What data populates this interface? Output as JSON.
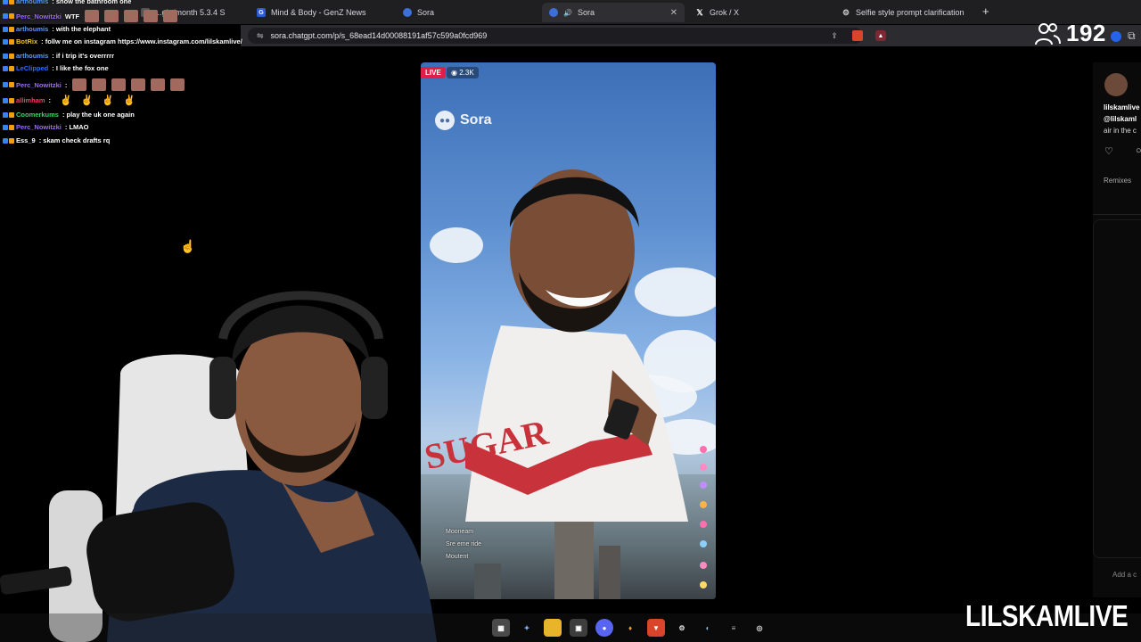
{
  "browser": {
    "tabs": [
      {
        "label": "...ght/month 5.3.4 S",
        "icon": "tab-icon",
        "active": false
      },
      {
        "label": "Mind & Body - GenZ News",
        "icon": "gz-icon",
        "active": false
      },
      {
        "label": "Sora",
        "icon": "sora-icon",
        "active": false
      },
      {
        "label": "Sora",
        "icon": "sora-icon",
        "active": true
      },
      {
        "label": "Grok / X",
        "icon": "x-icon",
        "active": false
      },
      {
        "label": "Selfie style prompt clarification",
        "icon": "openai-icon",
        "active": false
      }
    ],
    "url": "sora.chatgpt.com/p/s_68ead14d00088191af57c599a0fcd969"
  },
  "stream": {
    "viewer_count": "192"
  },
  "chat": [
    {
      "user": "arthoumis",
      "color": "#5b9bff",
      "message": ": show the bathroom one"
    },
    {
      "user": "Perc_Nowitzki",
      "color": "#9b6bff",
      "message": "WTF",
      "emotes": 5
    },
    {
      "user": "arthoumis",
      "color": "#5b9bff",
      "message": ": with the elephant"
    },
    {
      "user": "BotRix",
      "color": "#f0c33c",
      "message": ": follw me on instagram https://www.instagram.com/lilskamlive/"
    },
    {
      "user": "arthoumis",
      "color": "#5b9bff",
      "message": ": if i trip it's overrrrr"
    },
    {
      "user": "LeClipped",
      "color": "#2f6bff",
      "message": ": I like the fox one"
    },
    {
      "user": "Perc_Nowitzki",
      "color": "#9b6bff",
      "message": ":",
      "emotes": 6
    },
    {
      "user": "allimham",
      "color": "#ff3b6b",
      "message": ":",
      "hands": 4
    },
    {
      "user": "Coomerkums",
      "color": "#3fd46a",
      "message": ": play the uk one again"
    },
    {
      "user": "Perc_Nowitzki",
      "color": "#9b6bff",
      "message": ": LMAO"
    },
    {
      "user": "Ess_9",
      "color": "#ffffff",
      "message": ": skam check drafts rq"
    }
  ],
  "video": {
    "live_label": "LIVE",
    "view_count": "2.3K",
    "brand": "Sora",
    "shirt_text": "SUGAR",
    "overlay_comments": [
      "Mooneam",
      "Sre eme ride",
      "Moutent"
    ]
  },
  "side_panel": {
    "name": "lilskamlive",
    "handle": "@lilskaml",
    "caption": "air in the c",
    "remixes_label": "Remixes",
    "comment_placeholder": "Add a c"
  },
  "watermark": "LILSKAMLIVE",
  "colors": {
    "live_red": "#e11d48",
    "chrome_dark": "#1f1f22"
  }
}
